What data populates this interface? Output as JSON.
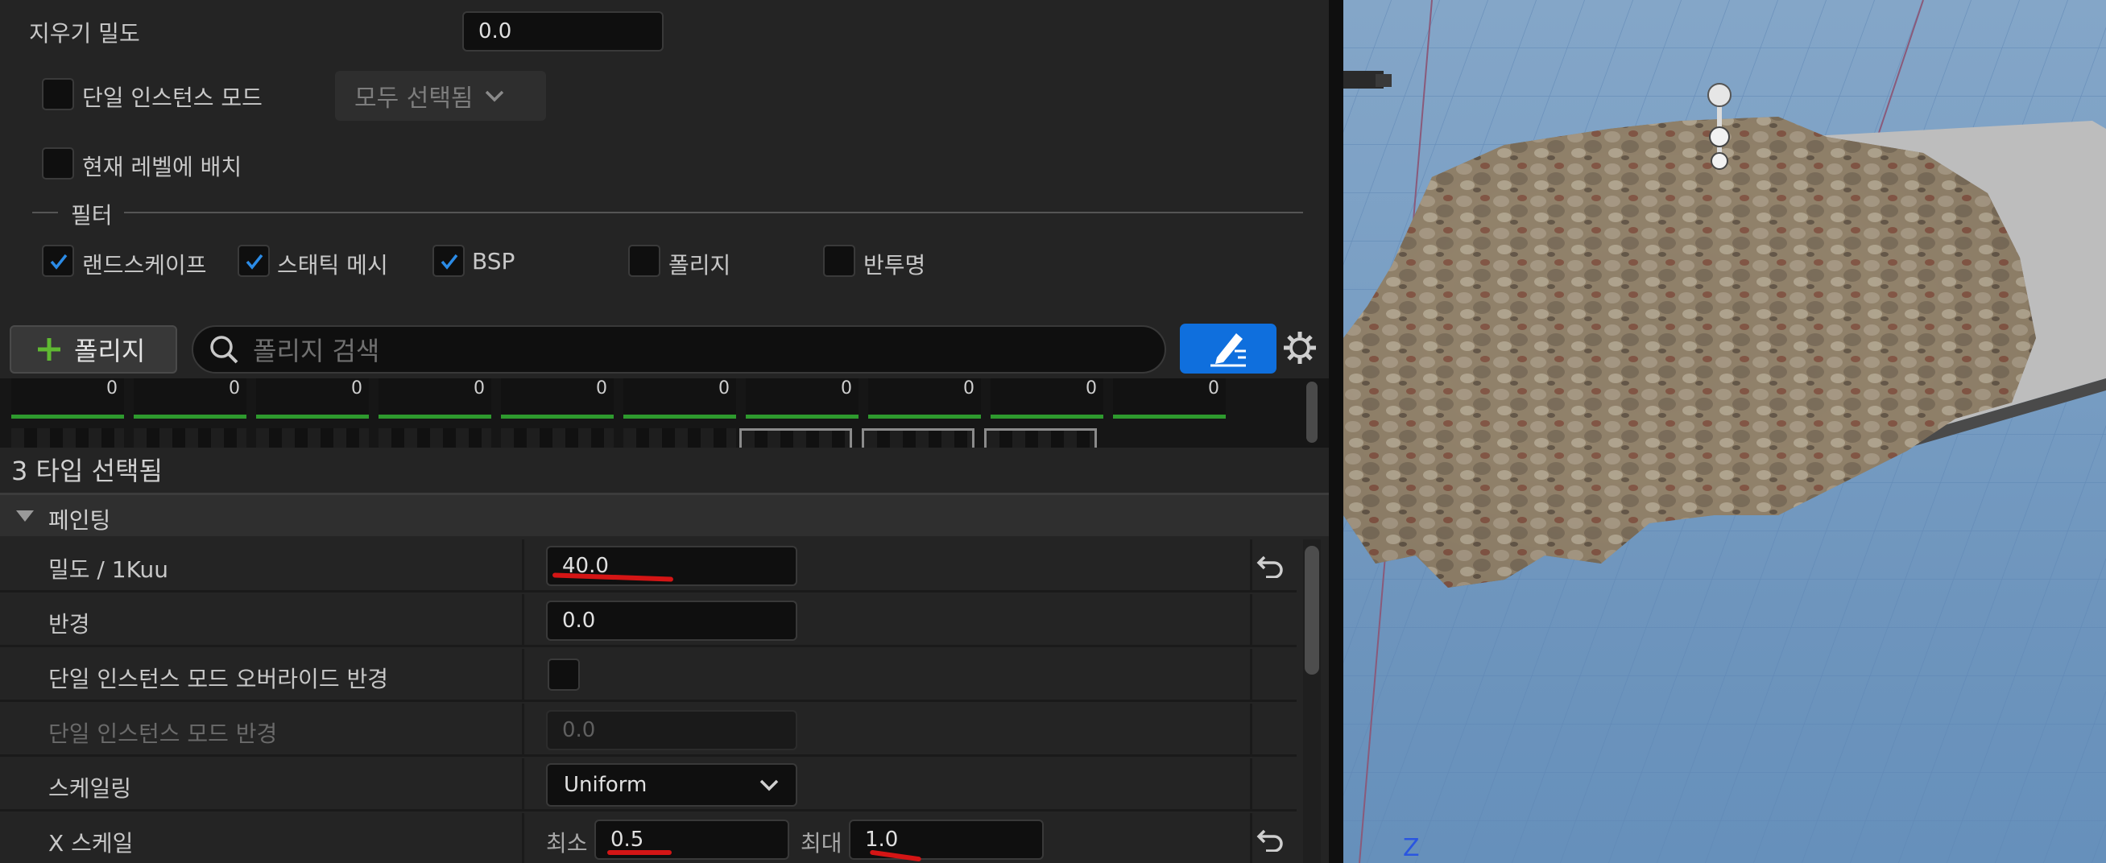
{
  "top": {
    "erase_density_label": "지우기 밀도",
    "erase_density_value": "0.0",
    "single_instance_label": "단일 인스턴스 모드",
    "select_all_label": "모두 선택됨",
    "current_level_label": "현재 레벨에 배치"
  },
  "filter": {
    "label": "필터",
    "items": [
      {
        "label": "랜드스케이프",
        "checked": true
      },
      {
        "label": "스태틱 메시",
        "checked": true
      },
      {
        "label": "BSP",
        "checked": true
      },
      {
        "label": "폴리지",
        "checked": false
      },
      {
        "label": "반투명",
        "checked": false
      }
    ]
  },
  "toolbar": {
    "add_foliage_label": "폴리지",
    "search_placeholder": "폴리지 검색"
  },
  "thumbnails": {
    "counts": [
      "0",
      "0",
      "0",
      "0",
      "0",
      "0",
      "0",
      "0",
      "0",
      "0"
    ]
  },
  "details": {
    "selected_types": "3 타입 선택됨",
    "section_painting": "페인팅",
    "density_label": "밀도 / 1Kuu",
    "density_value": "40.0",
    "radius_label": "반경",
    "radius_value": "0.0",
    "single_override_label": "단일 인스턴스 모드 오버라이드 반경",
    "single_radius_label": "단일 인스턴스 모드 반경",
    "single_radius_value": "0.0",
    "scaling_label": "스케일링",
    "scaling_value": "Uniform",
    "x_scale_label": "X 스케일",
    "min_label": "최소",
    "min_value": "0.5",
    "max_label": "최대",
    "max_value": "1.0"
  },
  "viewport": {
    "axis_label": "Z"
  },
  "colors": {
    "accent_blue": "#0f6fdd",
    "check_blue": "#2b8be6",
    "green_plus": "#5fb832",
    "annotation_red": "#d41515"
  }
}
